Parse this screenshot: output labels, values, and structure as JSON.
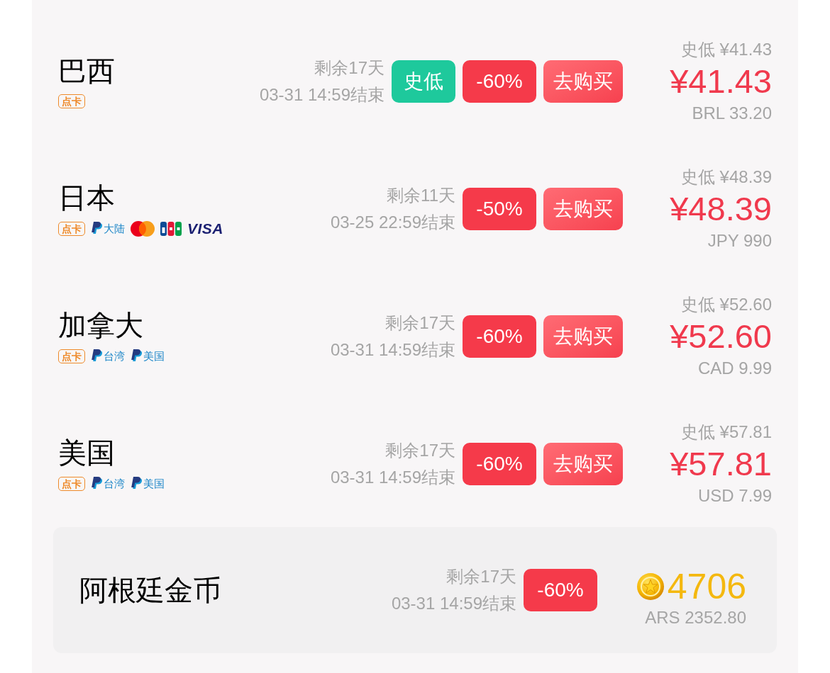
{
  "regions": [
    {
      "name": "巴西",
      "payments": [
        {
          "kind": "card",
          "label": "点卡"
        }
      ],
      "remaining": "剩余17天",
      "ends": "03-31 14:59结束",
      "tags": [
        {
          "kind": "low",
          "label": "史低"
        },
        {
          "kind": "discount",
          "label": "-60%"
        }
      ],
      "buy": "去购买",
      "lowest": "史低 ¥41.43",
      "price": "¥41.43",
      "local_price": "BRL 33.20"
    },
    {
      "name": "日本",
      "payments": [
        {
          "kind": "card",
          "label": "点卡"
        },
        {
          "kind": "paypal",
          "label": "大陆"
        },
        {
          "kind": "mastercard"
        },
        {
          "kind": "jcb"
        },
        {
          "kind": "visa",
          "label": "VISA"
        }
      ],
      "remaining": "剩余11天",
      "ends": "03-25 22:59结束",
      "tags": [
        {
          "kind": "discount",
          "label": "-50%"
        }
      ],
      "buy": "去购买",
      "lowest": "史低 ¥48.39",
      "price": "¥48.39",
      "local_price": "JPY 990"
    },
    {
      "name": "加拿大",
      "payments": [
        {
          "kind": "card",
          "label": "点卡"
        },
        {
          "kind": "paypal",
          "label": "台湾"
        },
        {
          "kind": "paypal",
          "label": "美国"
        }
      ],
      "remaining": "剩余17天",
      "ends": "03-31 14:59结束",
      "tags": [
        {
          "kind": "discount",
          "label": "-60%"
        }
      ],
      "buy": "去购买",
      "lowest": "史低 ¥52.60",
      "price": "¥52.60",
      "local_price": "CAD 9.99"
    },
    {
      "name": "美国",
      "payments": [
        {
          "kind": "card",
          "label": "点卡"
        },
        {
          "kind": "paypal",
          "label": "台湾"
        },
        {
          "kind": "paypal",
          "label": "美国"
        }
      ],
      "remaining": "剩余17天",
      "ends": "03-31 14:59结束",
      "tags": [
        {
          "kind": "discount",
          "label": "-60%"
        }
      ],
      "buy": "去购买",
      "lowest": "史低 ¥57.81",
      "price": "¥57.81",
      "local_price": "USD 7.99"
    }
  ],
  "coin_offer": {
    "name": "阿根廷金币",
    "remaining": "剩余17天",
    "ends": "03-31 14:59结束",
    "tags": [
      {
        "kind": "discount",
        "label": "-60%"
      }
    ],
    "coins": "4706",
    "local_price": "ARS 2352.80"
  }
}
